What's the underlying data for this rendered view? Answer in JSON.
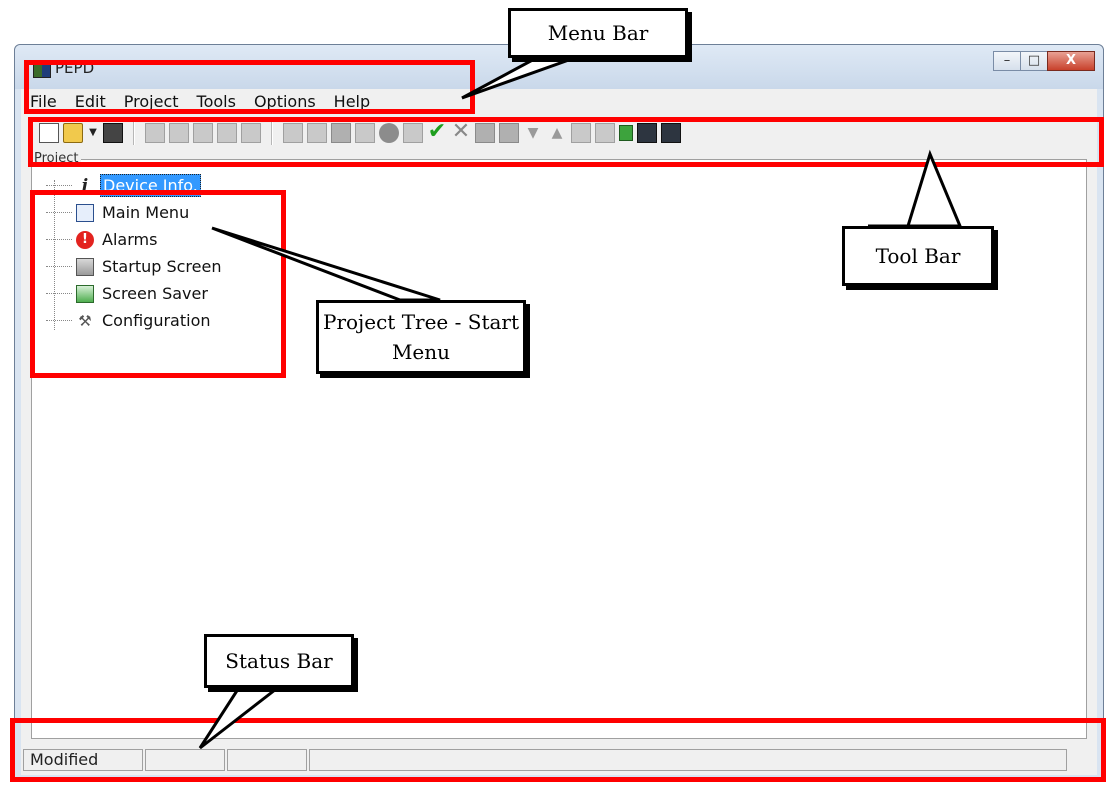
{
  "window": {
    "title": "PEPD",
    "controls": {
      "minimize": "–",
      "maximize": "□",
      "close": "X"
    }
  },
  "menubar": {
    "items": [
      "File",
      "Edit",
      "Project",
      "Tools",
      "Options",
      "Help"
    ]
  },
  "toolbar": {
    "icons": [
      "new-document-icon",
      "open-folder-icon",
      "dropdown-arrow-icon",
      "save-icon",
      "cut-icon",
      "copy-icon",
      "paste-icon",
      "duplicate-icon",
      "paste-special-icon",
      "add-screen-icon",
      "add-numeric-icon",
      "add-element-icon",
      "add-list-icon",
      "add-message-icon",
      "add-image-icon",
      "apply-check-icon",
      "cancel-x-icon",
      "move-in-icon",
      "move-out-icon",
      "move-down-icon",
      "move-up-icon",
      "menu-item-icon",
      "menu-add-icon",
      "download-icon",
      "export-icon",
      "export-run-icon"
    ]
  },
  "project": {
    "label": "Project",
    "tree": [
      {
        "label": "Device Info.",
        "icon": "info-icon",
        "selected": true
      },
      {
        "label": "Main Menu",
        "icon": "menu-icon"
      },
      {
        "label": "Alarms",
        "icon": "alarm-icon"
      },
      {
        "label": "Startup Screen",
        "icon": "image-icon"
      },
      {
        "label": "Screen Saver",
        "icon": "image-green-icon"
      },
      {
        "label": "Configuration",
        "icon": "tools-icon"
      }
    ]
  },
  "statusbar": {
    "panes": [
      "Modified",
      "",
      "",
      ""
    ]
  },
  "annotations": {
    "menu_bar": "Menu Bar",
    "tool_bar": "Tool Bar",
    "project_tree_line1": "Project Tree - Start",
    "project_tree_line2": "Menu",
    "status_bar": "Status Bar",
    "highlight_color": "#ff0000"
  }
}
